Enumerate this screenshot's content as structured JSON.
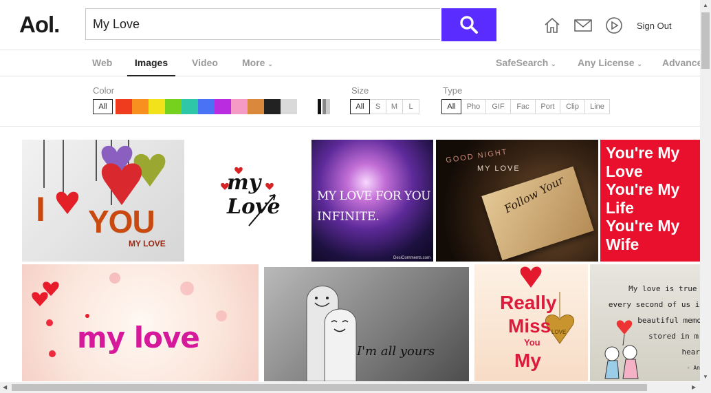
{
  "header": {
    "logo": "Aol.",
    "search_value": "My Love",
    "search_button_icon": "search-icon",
    "sign_out": "Sign Out",
    "brand_color": "#5b2cff"
  },
  "nav": {
    "tabs": [
      "Web",
      "Images",
      "Video",
      "More"
    ],
    "active_tab": "Images",
    "right": [
      "SafeSearch",
      "Any License",
      "Advanced"
    ]
  },
  "filters": {
    "color_label": "Color",
    "color_all": "All",
    "colors": [
      "#f03c1e",
      "#f7901e",
      "#f2e21b",
      "#76d11e",
      "#2ec7a8",
      "#4a72f5",
      "#b92ce0",
      "#f59ac4",
      "#d9883c",
      "#222222",
      "#d9d9d9",
      "#ffffff"
    ],
    "size_label": "Size",
    "sizes": [
      "All",
      "S",
      "M",
      "L"
    ],
    "type_label": "Type",
    "types": [
      "All",
      "Pho",
      "GIF",
      "Fac",
      "Port",
      "Clip",
      "Line"
    ]
  },
  "results": {
    "t1_big": "I",
    "t1_word": "YOU",
    "t1_sub": "MY LOVE",
    "t2_line1": "my",
    "t2_line2": "Love",
    "t3_line1": "MY LOVE FOR YOU IS",
    "t3_line2": "INFINITE.",
    "t3_credit": "DesiComments.com",
    "t4_top1": "GOOD NIGHT",
    "t4_top2": "MY LOVE",
    "t4_note": "Follow Your",
    "t5_lines": [
      "You're My",
      "Love",
      "You're My",
      "Life",
      "You're My",
      "Wife"
    ],
    "t6_text": "my love",
    "t7_text": "I'm all yours",
    "t8_line1": "Really",
    "t8_line2": "Miss",
    "t8_line3": "You",
    "t8_line4": "My",
    "t8_heart": "LOVE",
    "t9_lines": [
      "My love is true and",
      "every second of us is",
      "beautiful memo",
      "stored in m",
      "hear",
      "- An"
    ]
  }
}
